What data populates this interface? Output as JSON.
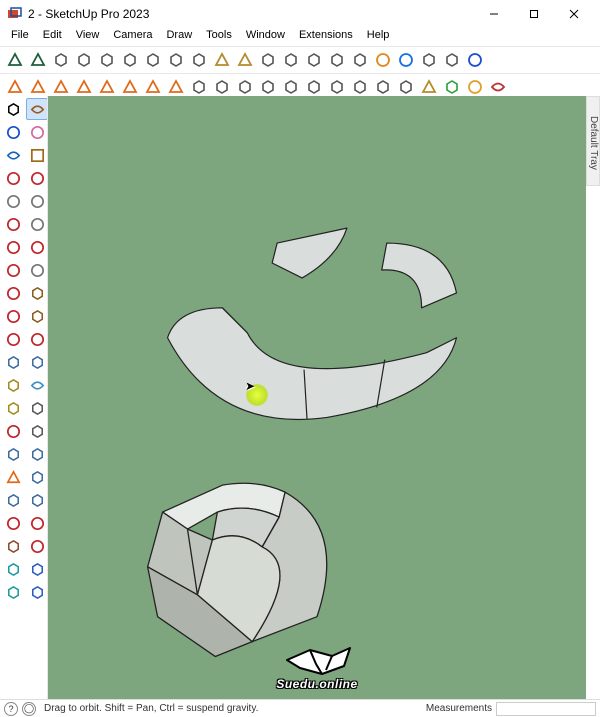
{
  "titlebar": {
    "title": "2 - SketchUp Pro 2023"
  },
  "menubar": [
    "File",
    "Edit",
    "View",
    "Camera",
    "Draw",
    "Tools",
    "Window",
    "Extensions",
    "Help"
  ],
  "statusbar": {
    "hint": "Drag to orbit. Shift = Pan, Ctrl = suspend gravity.",
    "measurements_label": "Measurements"
  },
  "right_tray": {
    "label": "Default Tray"
  },
  "watermark": {
    "text": "Suedu.online"
  },
  "top_toolbar_row1": [
    {
      "name": "vray-icon",
      "color": "#1d5e3a"
    },
    {
      "name": "leaf-icon",
      "color": "#1d5e3a"
    },
    {
      "name": "teapot-icon",
      "color": "#555"
    },
    {
      "name": "teapot-outline-icon",
      "color": "#555"
    },
    {
      "name": "render-icon",
      "color": "#555"
    },
    {
      "name": "camera-icon",
      "color": "#555"
    },
    {
      "name": "frame-icon",
      "color": "#555"
    },
    {
      "name": "monitor-icon",
      "color": "#555"
    },
    {
      "name": "clapper-icon",
      "color": "#555"
    },
    {
      "name": "clipboard-icon",
      "color": "#b58a2a"
    },
    {
      "name": "lock-icon",
      "color": "#b58a2a"
    },
    {
      "name": "rotate3d-icon",
      "color": "#555"
    },
    {
      "name": "cube-shadow-icon",
      "color": "#555"
    },
    {
      "name": "diag-hatch-icon",
      "color": "#555"
    },
    {
      "name": "wire-cube-icon",
      "color": "#555"
    },
    {
      "name": "solid-cube-icon",
      "color": "#555"
    },
    {
      "name": "box-orange-icon",
      "color": "#e08a1a"
    },
    {
      "name": "palette-icon",
      "color": "#1a70e0"
    },
    {
      "name": "axis-ring-icon",
      "color": "#555"
    },
    {
      "name": "compass-icon",
      "color": "#555"
    },
    {
      "name": "f6-script-icon",
      "color": "#1a4fd0"
    }
  ],
  "top_toolbar_row2": [
    {
      "name": "sun-icon",
      "color": "#e06a1a"
    },
    {
      "name": "lasso-orange-icon",
      "color": "#e06a1a"
    },
    {
      "name": "circle-orange-icon",
      "color": "#e06a1a"
    },
    {
      "name": "triangle-icon",
      "color": "#e06a1a"
    },
    {
      "name": "spark-icon",
      "color": "#e06a1a"
    },
    {
      "name": "flare-icon",
      "color": "#e06a1a"
    },
    {
      "name": "half-sun-icon",
      "color": "#e06a1a"
    },
    {
      "name": "ring-orange-icon",
      "color": "#e06a1a"
    },
    {
      "name": "platform-icon",
      "color": "#555"
    },
    {
      "name": "extrude-icon",
      "color": "#555"
    },
    {
      "name": "fan-icon",
      "color": "#555"
    },
    {
      "name": "curve-tool-icon",
      "color": "#555"
    },
    {
      "name": "slant-box-icon",
      "color": "#555"
    },
    {
      "name": "offset-icon",
      "color": "#555"
    },
    {
      "name": "intersect-icon",
      "color": "#555"
    },
    {
      "name": "union-icon",
      "color": "#555"
    },
    {
      "name": "subtract-icon",
      "color": "#555"
    },
    {
      "name": "target-icon",
      "color": "#555"
    },
    {
      "name": "package-icon",
      "color": "#b58a2a"
    },
    {
      "name": "selection-icon",
      "color": "#2aa038"
    },
    {
      "name": "hex-icon",
      "color": "#e0a030"
    },
    {
      "name": "red-frame-icon",
      "color": "#c03030"
    }
  ],
  "left_toolbar": [
    {
      "name": "select-arrow-icon",
      "color": "#000",
      "sel": false
    },
    {
      "name": "orbit-eye-icon",
      "color": "#9a5a1a",
      "sel": true
    },
    {
      "name": "paint-bucket-icon",
      "color": "#1a4fd0",
      "sel": false
    },
    {
      "name": "eraser-icon",
      "color": "#d46aa0",
      "sel": false
    },
    {
      "name": "cube-blue-icon",
      "color": "#1a60c0",
      "sel": false
    },
    {
      "name": "pencil-icon",
      "color": "#a06a1a",
      "sel": false
    },
    {
      "name": "line-red-icon",
      "color": "#c0262a",
      "sel": false
    },
    {
      "name": "freehand-red-icon",
      "color": "#c0262a",
      "sel": false
    },
    {
      "name": "rectangle-icon",
      "color": "#777",
      "sel": false
    },
    {
      "name": "circle-icon",
      "color": "#777",
      "sel": false
    },
    {
      "name": "disc-red-icon",
      "color": "#c0262a",
      "sel": false
    },
    {
      "name": "circle-gray-icon",
      "color": "#777",
      "sel": false
    },
    {
      "name": "arc-red-icon",
      "color": "#c0262a",
      "sel": false
    },
    {
      "name": "arc2-red-icon",
      "color": "#c0262a",
      "sel": false
    },
    {
      "name": "pie-red-icon",
      "color": "#c0262a",
      "sel": false
    },
    {
      "name": "corner-icon",
      "color": "#777",
      "sel": false
    },
    {
      "name": "move-icon",
      "color": "#c0262a",
      "sel": false
    },
    {
      "name": "pushpull-icon",
      "color": "#8a5a1a",
      "sel": false
    },
    {
      "name": "rotate-icon",
      "color": "#c0262a",
      "sel": false
    },
    {
      "name": "followme-icon",
      "color": "#8a5a1a",
      "sel": false
    },
    {
      "name": "scale-icon",
      "color": "#c0262a",
      "sel": false
    },
    {
      "name": "offset-red-icon",
      "color": "#c0262a",
      "sel": false
    },
    {
      "name": "outer-shell-icon",
      "color": "#3a6aa0",
      "sel": false
    },
    {
      "name": "skew-icon",
      "color": "#3a6aa0",
      "sel": false
    },
    {
      "name": "tape-measure-icon",
      "color": "#a08a1a",
      "sel": false
    },
    {
      "name": "dimension-icon",
      "color": "#3a90c0",
      "sel": false
    },
    {
      "name": "protractor-icon",
      "color": "#a08a1a",
      "sel": false
    },
    {
      "name": "text-label-icon",
      "color": "#555",
      "sel": false
    },
    {
      "name": "axes-tool-icon",
      "color": "#c0262a",
      "sel": false
    },
    {
      "name": "3dtext-icon",
      "color": "#555",
      "sel": false
    },
    {
      "name": "walk-icon",
      "color": "#3a6aa0",
      "sel": false
    },
    {
      "name": "look-icon",
      "color": "#3a6aa0",
      "sel": false
    },
    {
      "name": "section-plane-icon",
      "color": "#e06a1a",
      "sel": false
    },
    {
      "name": "plane-arrow-icon",
      "color": "#3a6aa0",
      "sel": false
    },
    {
      "name": "zoom-find-icon",
      "color": "#3a6aa0",
      "sel": false
    },
    {
      "name": "zoom-extents-icon",
      "color": "#3a6aa0",
      "sel": false
    },
    {
      "name": "expand-red-icon",
      "color": "#c0262a",
      "sel": false
    },
    {
      "name": "contract-red-icon",
      "color": "#c0262a",
      "sel": false
    },
    {
      "name": "footprints-icon",
      "color": "#8a4a2a",
      "sel": false
    },
    {
      "name": "marker-icon",
      "color": "#c0262a",
      "sel": false
    },
    {
      "name": "gear-teal-icon",
      "color": "#1a9a9a",
      "sel": false
    },
    {
      "name": "wave-blue-icon",
      "color": "#2a5ac0",
      "sel": false
    },
    {
      "name": "star-teal-icon",
      "color": "#1a9a9a",
      "sel": false
    },
    {
      "name": "globe-icon",
      "color": "#2a5ac0",
      "sel": false
    }
  ]
}
